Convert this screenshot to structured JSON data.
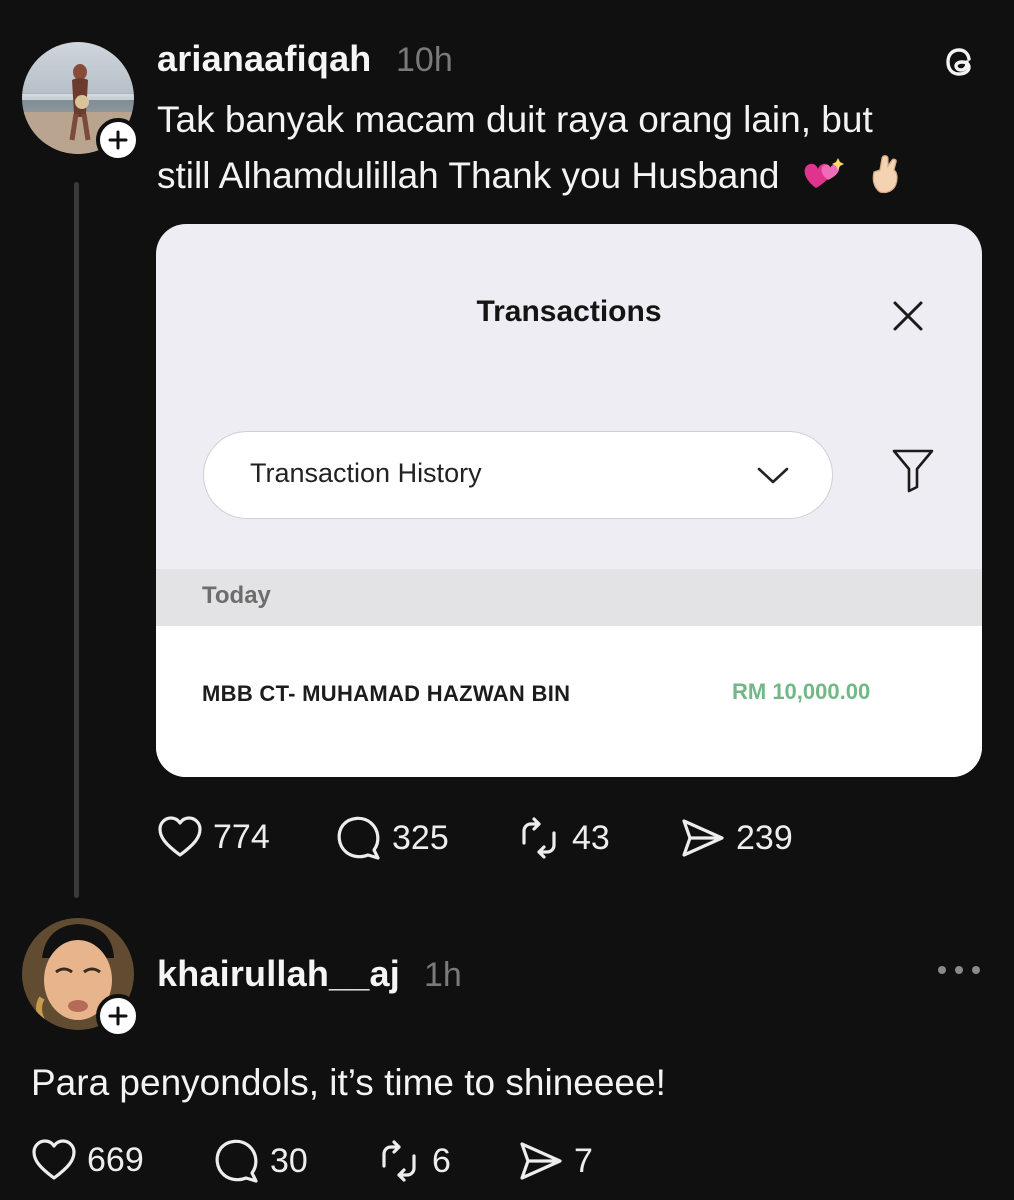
{
  "post1": {
    "username": "arianaafiqah",
    "time": "10h",
    "text_line1": "Tak banyak macam duit raya orang lain, but",
    "text_line2": "still Alhamdulillah Thank you Husband",
    "emoji": [
      "sparkling-hearts",
      "raised-hand-light-skin"
    ],
    "card": {
      "title": "Transactions",
      "dropdown_value": "Transaction History",
      "section": "Today",
      "transaction_name": "MBB CT- MUHAMAD HAZWAN BIN",
      "transaction_amount": "RM 10,000.00",
      "amount_color": "#72b887"
    },
    "stats": {
      "likes": "774",
      "replies": "325",
      "reposts": "43",
      "shares": "239"
    }
  },
  "post2": {
    "username": "khairullah__aj",
    "time": "1h",
    "text": "Para penyondols, it’s time to shineeee!",
    "stats": {
      "likes": "669",
      "replies": "30",
      "reposts": "6",
      "shares": "7"
    }
  },
  "icons": [
    "threads-logo-icon",
    "plus-icon",
    "close-icon",
    "chevron-down-icon",
    "filter-icon",
    "heart-icon",
    "comment-icon",
    "repost-icon",
    "share-icon",
    "more-icon"
  ]
}
